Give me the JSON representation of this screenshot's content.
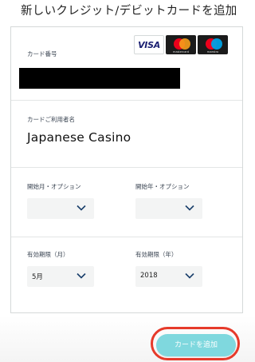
{
  "page": {
    "title": "新しいクレジット/デビットカードを追加"
  },
  "card_number": {
    "label": "カード番号",
    "value_redacted": true,
    "logos": [
      {
        "name": "visa",
        "text": "VISA"
      },
      {
        "name": "mastercard",
        "text": "mastercard"
      },
      {
        "name": "maestro",
        "text": "maestro"
      }
    ]
  },
  "cardholder": {
    "label": "カードご利用者名",
    "value": "Japanese Casino"
  },
  "start_date": {
    "month_label": "開始月・オプション",
    "month_value": "",
    "year_label": "開始年・オプション",
    "year_value": ""
  },
  "expiry": {
    "month_label": "有効期限（月）",
    "month_value": "5月",
    "year_label": "有効期限（年）",
    "year_value": "2018"
  },
  "actions": {
    "add_card_label": "カードを追加"
  },
  "colors": {
    "button": "#7fd8de",
    "highlight_ring": "#e63a2a",
    "chevron": "#1a3f6b"
  }
}
